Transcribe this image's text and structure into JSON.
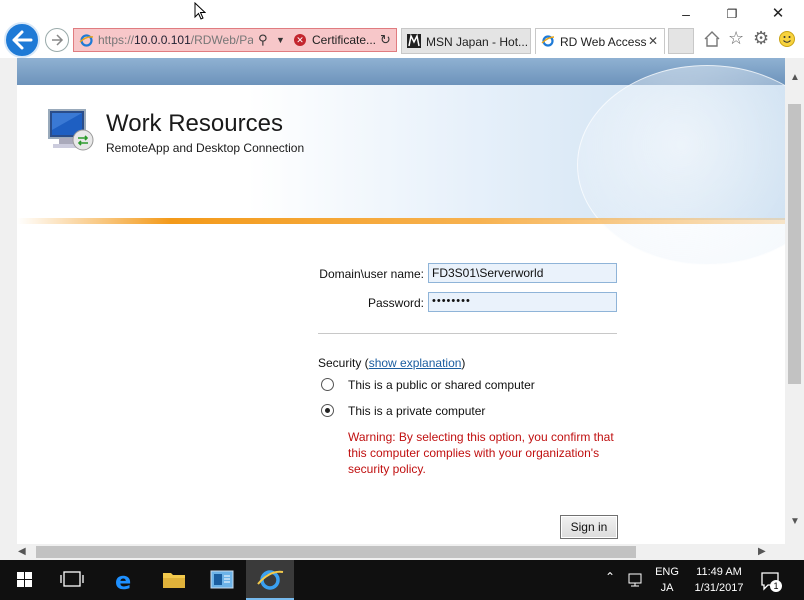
{
  "browser": {
    "url_prefix": "https://",
    "url_host": "10.0.0.101",
    "url_path": "/RDWeb/Pa",
    "cert_warning": "Certificate...",
    "tabs": [
      {
        "label": "MSN Japan - Hot...",
        "active": false
      },
      {
        "label": "RD Web Access",
        "active": true
      }
    ]
  },
  "header": {
    "title": "Work Resources",
    "subtitle": "RemoteApp and Desktop Connection"
  },
  "form": {
    "domain_label": "Domain\\user name:",
    "domain_value": "FD3S01\\Serverworld",
    "password_label": "Password:",
    "password_value": "••••••••",
    "security_prefix": "Security (",
    "security_link": "show explanation",
    "security_suffix": ")",
    "options": [
      {
        "label": "This is a public or shared computer",
        "selected": false
      },
      {
        "label": "This is a private computer",
        "selected": true
      }
    ],
    "warning": "Warning: By selecting this option, you confirm that this computer complies with your organization's security policy.",
    "signin_label": "Sign in"
  },
  "taskbar": {
    "lang_top": "ENG",
    "lang_bottom": "JA",
    "time": "11:49 AM",
    "date": "1/31/2017",
    "notifications": "1"
  },
  "colors": {
    "accent": "#1e7ad6",
    "cert_error_bg": "#f7c7c9",
    "warning_text": "#c01010",
    "header_orange": "#f39a1a"
  }
}
